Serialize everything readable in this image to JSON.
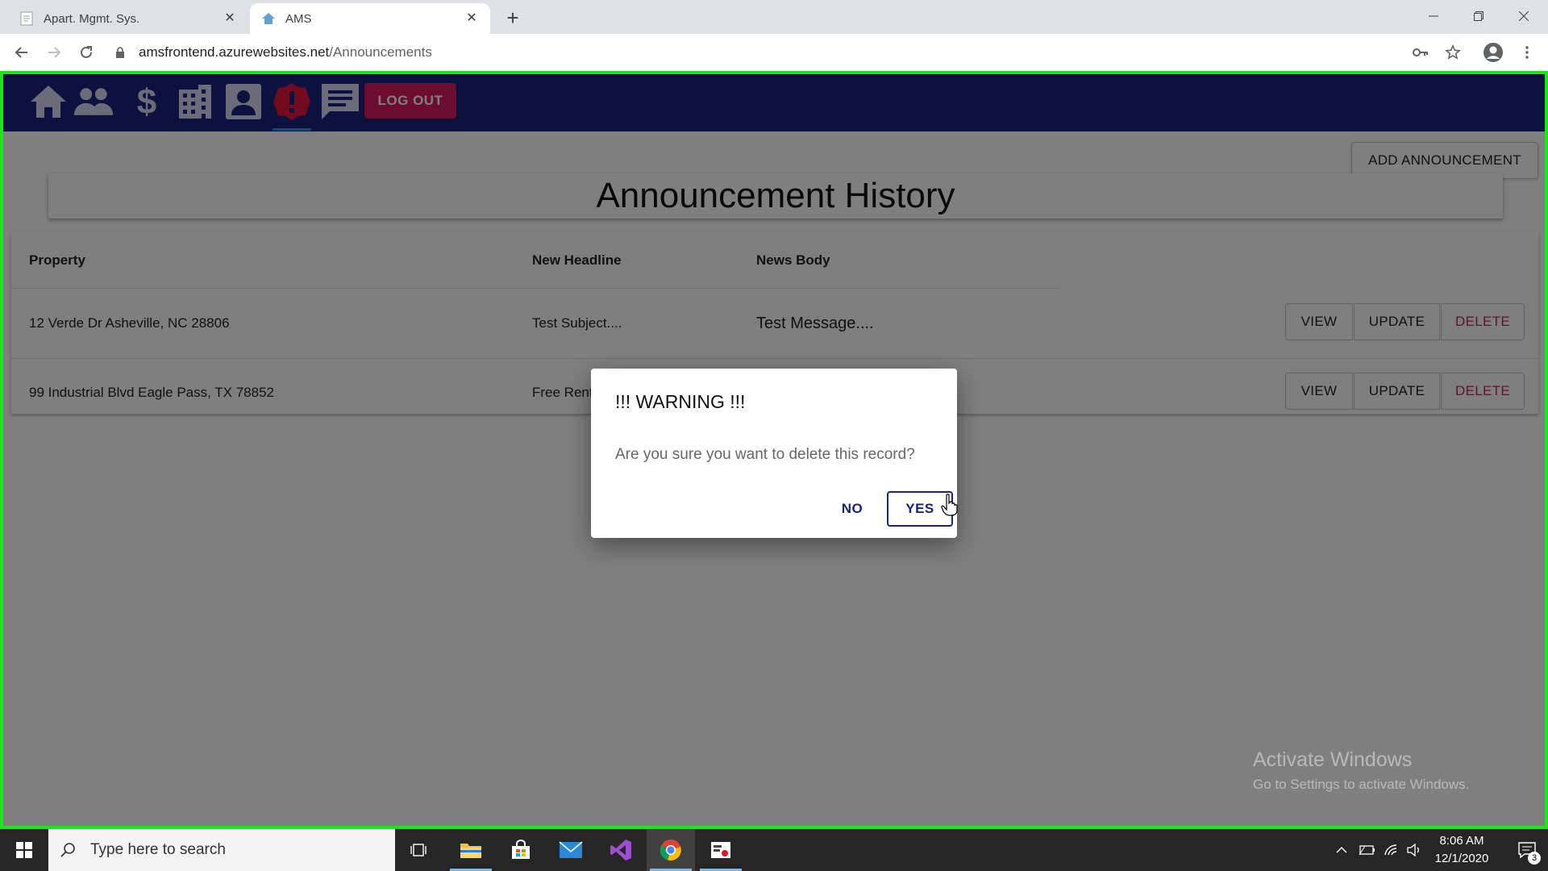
{
  "browser": {
    "tabs": [
      {
        "title": "Apart. Mgmt. Sys.",
        "close": "✕"
      },
      {
        "title": "AMS",
        "close": "✕"
      }
    ],
    "new_tab": "+",
    "url_host": "amsfrontend.azurewebsites.net",
    "url_path": "/Announcements"
  },
  "app": {
    "nav_icons": [
      "home-icon",
      "people-icon",
      "dollar-icon",
      "building-icon",
      "account-box-icon",
      "alert-icon",
      "message-icon"
    ],
    "logout_label": "LOG OUT",
    "add_label": "ADD ANNOUNCEMENT",
    "page_title": "Announcement History",
    "table": {
      "headers": [
        "Property",
        "New Headline",
        "News Body"
      ],
      "rows": [
        {
          "property": "12 Verde Dr Asheville, NC 28806",
          "headline": "Test Subject....",
          "body": "Test Message...."
        },
        {
          "property": "99 Industrial Blvd Eagle Pass, TX 78852",
          "headline": "Free Rent",
          "body": ""
        }
      ],
      "actions": {
        "view": "VIEW",
        "update": "UPDATE",
        "delete": "DELETE"
      }
    },
    "dialog": {
      "title": "!!! WARNING !!!",
      "message": "Are you sure you want to delete this record?",
      "no_label": "NO",
      "yes_label": "YES"
    },
    "watermark": {
      "line1": "Activate Windows",
      "line2": "Go to Settings to activate Windows."
    },
    "colors": {
      "appbar": "#1a237e",
      "accent_pink": "#d81b60",
      "frame_green": "#19e619"
    }
  },
  "taskbar": {
    "search_placeholder": "Type here to search",
    "time": "8:06 AM",
    "date": "12/1/2020",
    "notification_count": "3"
  }
}
